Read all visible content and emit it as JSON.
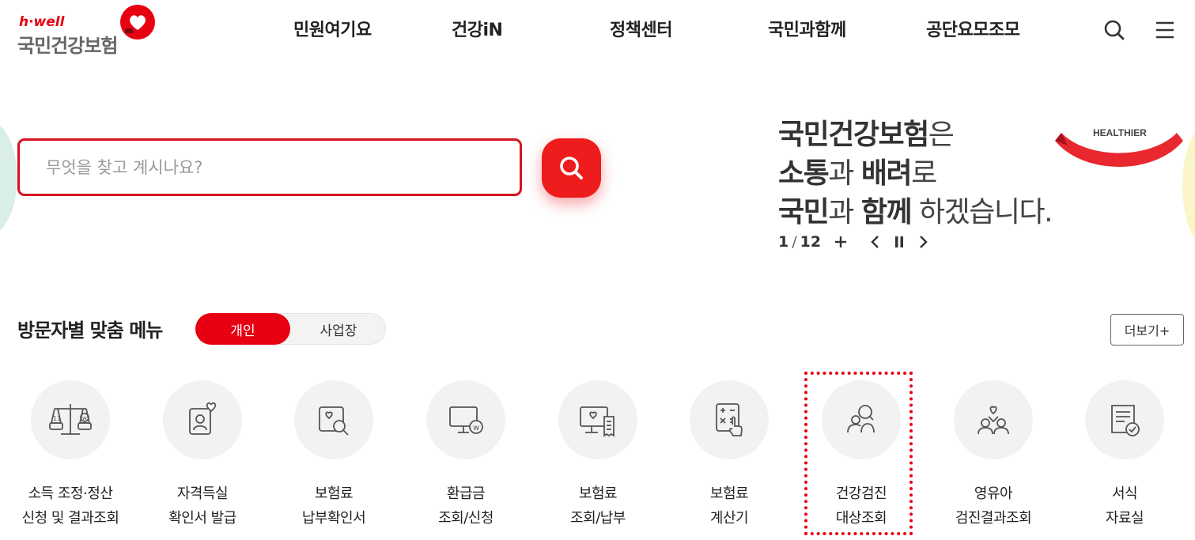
{
  "header": {
    "logo_tag": "h·well",
    "logo_name": "국민건강보험",
    "nav": [
      "민원여기요",
      "건강iN",
      "정책센터",
      "국민과함께",
      "공단요모조모"
    ],
    "search_icon": "search-icon",
    "menu_icon": "hamburger-menu-icon"
  },
  "search": {
    "placeholder": "무엇을 찾고 계시나요?",
    "button_icon": "search-icon"
  },
  "banner": {
    "line1_bold": "국민건강보험",
    "line1_rest": "은",
    "line2_bold1": "소통",
    "line2_mid": "과 ",
    "line2_bold2": "배려",
    "line2_rest": "로",
    "line3_bold1": "국민",
    "line3_mid": "과 ",
    "line3_bold2": "함께",
    "line3_rest": " 하겠습니다.",
    "ribbon_text": "HEALTHIER",
    "current": "1",
    "separator": "/",
    "total": "12",
    "accent_color": "#e60012"
  },
  "visitor_menu": {
    "title": "방문자별 맞춤 메뉴",
    "tabs": [
      "개인",
      "사업장"
    ],
    "active_tab": "개인",
    "more_label": "더보기+",
    "items": [
      {
        "line1": "소득 조정·정산",
        "line2": "신청 및 결과조회",
        "icon": "scale-icon"
      },
      {
        "line1": "자격득실",
        "line2": "확인서 발급",
        "icon": "id-card-heart-icon"
      },
      {
        "line1": "보험료",
        "line2": "납부확인서",
        "icon": "document-search-icon"
      },
      {
        "line1": "환급금",
        "line2": "조회/신청",
        "icon": "monitor-won-icon"
      },
      {
        "line1": "보험료",
        "line2": "조회/납부",
        "icon": "monitor-receipt-icon"
      },
      {
        "line1": "보험료",
        "line2": "계산기",
        "icon": "calculator-icon"
      },
      {
        "line1": "건강검진",
        "line2": "대상조회",
        "icon": "people-search-icon"
      },
      {
        "line1": "영유아",
        "line2": "검진결과조회",
        "icon": "family-heart-icon"
      },
      {
        "line1": "서식",
        "line2": "자료실",
        "icon": "form-check-icon"
      }
    ]
  }
}
